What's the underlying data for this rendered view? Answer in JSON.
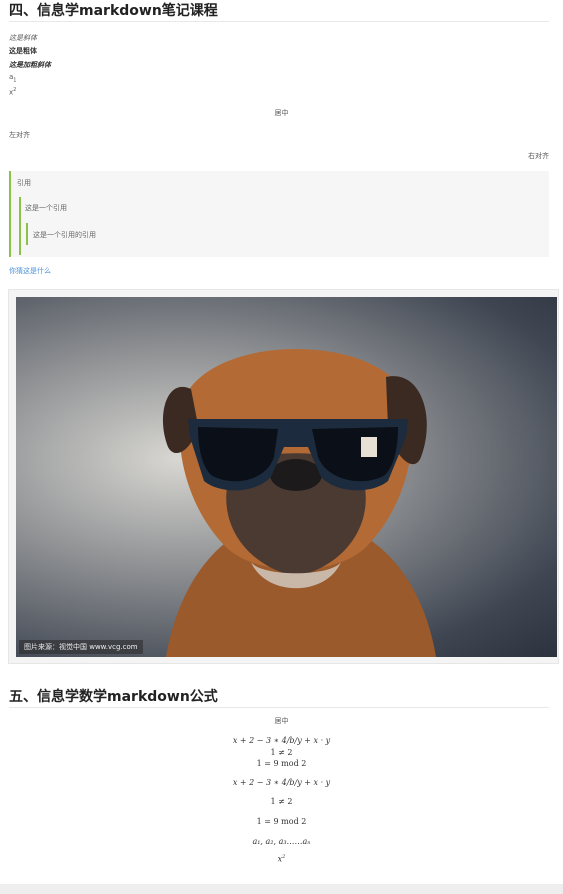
{
  "section4": {
    "title": "四、信息学markdown笔记课程",
    "italic": "这是斜体",
    "bold": "这是粗体",
    "bold_italic": "这是加粗斜体",
    "sub_base": "a",
    "sub_index": "1",
    "sup_base": "x",
    "sup_index": "2",
    "center": "居中",
    "left": "左对齐",
    "right": "右对齐",
    "quote_l1": "引用",
    "quote_l2": "这是一个引用",
    "quote_l3": "这是一个引用的引用",
    "link": "你猜这是什么",
    "image_caption": "图片来源：视觉中国 www.vcg.com"
  },
  "section5": {
    "title": "五、信息学数学markdown公式",
    "center": "居中",
    "f1": "x + 2 − 3 ∗ 4/b/y + x · y",
    "f2": "1 ≠ 2",
    "f3": "1 = 9 mod 2",
    "f4": "x + 2 − 3 ∗ 4/b/y + x · y",
    "f5": "1 ≠ 2",
    "f6": "1 = 9 mod 2",
    "f7": "a₁, a₂, a₃……aₙ",
    "f8_base": "x",
    "f8_exp": "2"
  },
  "colors": {
    "quote_border": "#8bc34a",
    "link": "#4a90d9"
  }
}
